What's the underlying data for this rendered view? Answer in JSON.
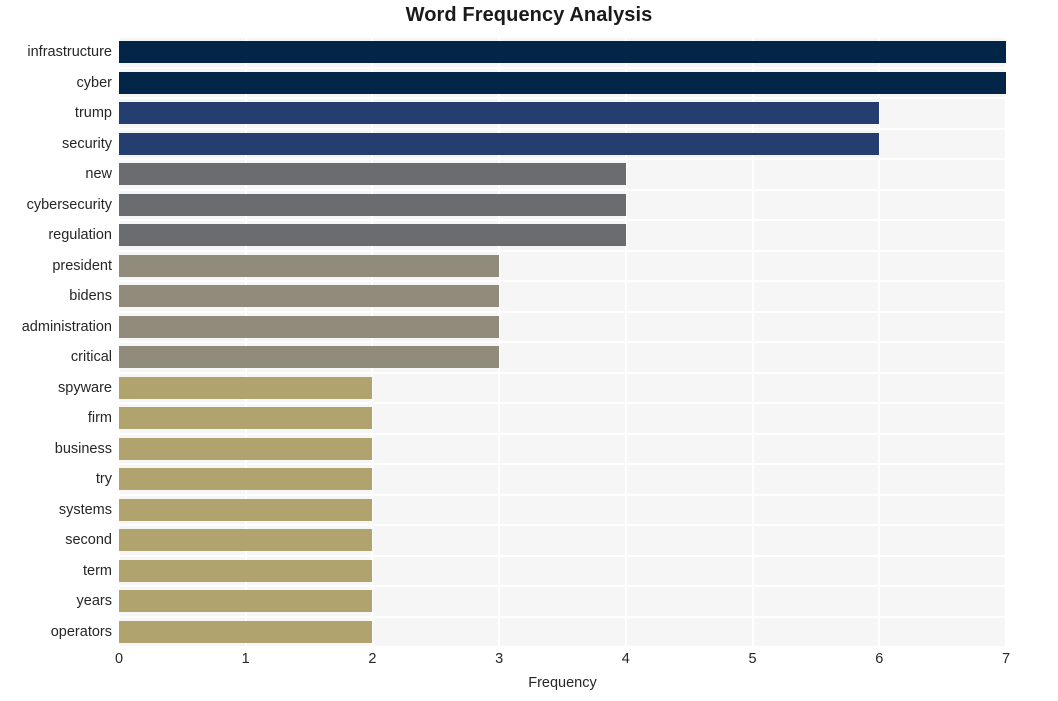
{
  "chart_data": {
    "type": "bar",
    "orientation": "horizontal",
    "title": "Word Frequency Analysis",
    "xlabel": "Frequency",
    "ylabel": "",
    "categories": [
      "infrastructure",
      "cyber",
      "trump",
      "security",
      "new",
      "cybersecurity",
      "regulation",
      "president",
      "bidens",
      "administration",
      "critical",
      "spyware",
      "firm",
      "business",
      "try",
      "systems",
      "second",
      "term",
      "years",
      "operators"
    ],
    "values": [
      7,
      7,
      6,
      6,
      4,
      4,
      4,
      3,
      3,
      3,
      3,
      2,
      2,
      2,
      2,
      2,
      2,
      2,
      2,
      2
    ],
    "bar_colors": [
      "#022548",
      "#022548",
      "#243f6f",
      "#243f6f",
      "#6b6c70",
      "#6b6c70",
      "#6b6c70",
      "#918b7c",
      "#918b7c",
      "#918b7c",
      "#918b7c",
      "#b0a36d",
      "#b0a36d",
      "#b0a36d",
      "#b0a36d",
      "#b0a36d",
      "#b0a36d",
      "#b0a36d",
      "#b0a36d",
      "#b0a36d"
    ],
    "xlim": [
      0,
      7.0
    ],
    "xticks": [
      0,
      1,
      2,
      3,
      4,
      5,
      6,
      7
    ],
    "xtick_labels": [
      "0",
      "1",
      "2",
      "3",
      "4",
      "5",
      "6",
      "7"
    ],
    "grid": true,
    "grid_color": "#ffffff",
    "plot_background": "#f6f6f7",
    "figure_background": "#ffffff",
    "legend": null
  }
}
